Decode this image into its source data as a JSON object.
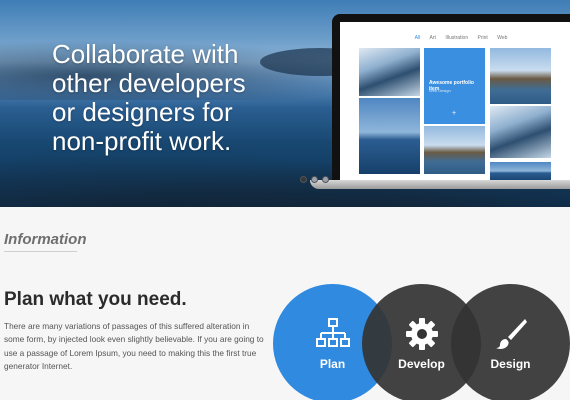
{
  "hero": {
    "headline_lines": [
      "Collaborate with",
      "other developers",
      "or designers for",
      "non-profit work."
    ],
    "slider_dots": 3,
    "active_dot": 0
  },
  "portfolio_preview": {
    "nav": [
      "All",
      "Art",
      "Illustration",
      "Print",
      "Web"
    ],
    "active_nav": "All",
    "featured_title": "Awesome portfolio item",
    "featured_subtitle": "Web Design",
    "featured_icon": "+"
  },
  "information": {
    "section_title": "Information",
    "heading": "Plan what you need.",
    "body": "There are many variations of passages of this suffered alteration in some form, by injected look even slightly believable. If you are going to use a passage of Lorem Ipsum, you need to making this the first true generator Internet."
  },
  "steps": [
    {
      "label": "Plan",
      "icon": "sitemap-icon",
      "color": "#2f8ae0"
    },
    {
      "label": "Develop",
      "icon": "gear-icon",
      "color": "#343434"
    },
    {
      "label": "Design",
      "icon": "paintbrush-icon",
      "color": "#343434"
    }
  ]
}
